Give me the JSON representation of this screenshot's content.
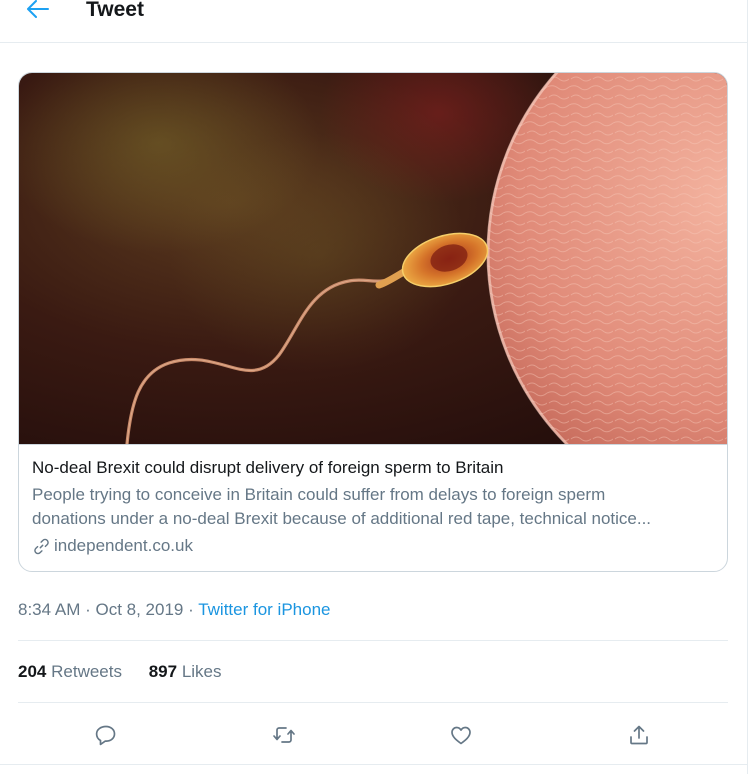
{
  "header": {
    "title": "Tweet",
    "back_icon": "arrow-left-icon"
  },
  "card": {
    "title": "No-deal Brexit could disrupt delivery of foreign sperm to Britain",
    "description_line1": "People trying to conceive in Britain could suffer from delays to foreign sperm",
    "description_line2": "donations under a no-deal Brexit because of additional red tape, technical notice...",
    "domain": "independent.co.uk",
    "domain_icon": "link-icon"
  },
  "meta": {
    "timestamp": "8:34 AM · Oct 8, 2019",
    "separator": "·",
    "source": "Twitter for iPhone"
  },
  "stats": {
    "retweets_count": "204",
    "retweets_label": "Retweets",
    "likes_count": "897",
    "likes_label": "Likes"
  },
  "actions": [
    "reply-icon",
    "retweet-icon",
    "like-icon",
    "share-icon"
  ],
  "colors": {
    "accent": "#1da1f2",
    "link": "#1b95e0",
    "text": "#14171a",
    "muted": "#657786",
    "border": "#e6ecf0"
  }
}
